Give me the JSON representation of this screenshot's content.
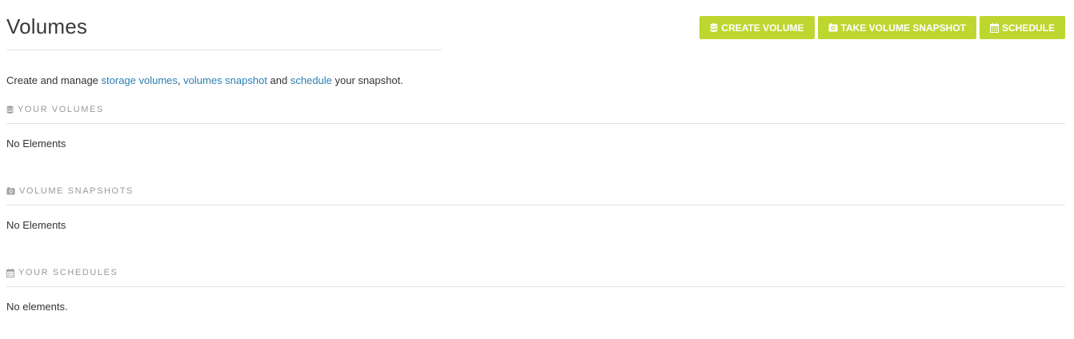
{
  "page": {
    "title": "Volumes"
  },
  "toolbar": {
    "create_volume": {
      "label": "CREATE VOLUME",
      "icon": "database-icon"
    },
    "take_snapshot": {
      "label": "TAKE VOLUME SNAPSHOT",
      "icon": "camera-icon"
    },
    "schedule": {
      "label": "SCHEDULE",
      "icon": "calendar-icon"
    },
    "button_color": "#bed630"
  },
  "intro": {
    "prefix": "Create and manage ",
    "link_storage_volumes": "storage volumes",
    "sep1": ", ",
    "link_volumes_snapshot": "volumes snapshot",
    "sep2": " and ",
    "link_schedule": "schedule",
    "suffix": " your snapshot.",
    "link_color": "#2a7fb4"
  },
  "sections": {
    "volumes": {
      "heading": "YOUR VOLUMES",
      "icon": "database-icon",
      "empty_text": "No Elements"
    },
    "snapshots": {
      "heading": "VOLUME SNAPSHOTS",
      "icon": "camera-icon",
      "empty_text": "No Elements"
    },
    "schedules": {
      "heading": "YOUR SCHEDULES",
      "icon": "calendar-icon",
      "empty_text": "No elements."
    }
  }
}
